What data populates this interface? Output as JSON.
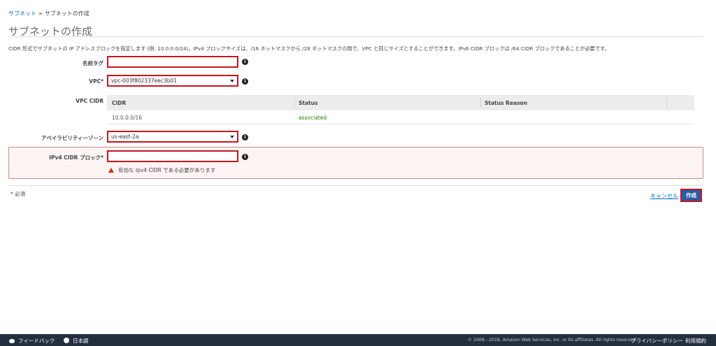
{
  "breadcrumb": {
    "root": "サブネット",
    "separator": " > ",
    "current": "サブネットの作成"
  },
  "page": {
    "title": "サブネットの作成",
    "description": "CIDR 形式でサブネットの IP アドレスブロックを指定します (例: 10.0.0.0/24)。IPv4 ブロックサイズは、/16 ネットマスクから /28 ネットマスクの間で、VPC と同じサイズとすることができます。IPv6 CIDR ブロックは /64 CIDR ブロックであることが必要です。"
  },
  "form": {
    "name_tag": {
      "label": "名前タグ",
      "value": ""
    },
    "vpc": {
      "label": "VPC*",
      "value": "vpc-003f802337eec3b01"
    },
    "vpc_cidr": {
      "label": "VPC CIDR",
      "columns": [
        "CIDR",
        "Status",
        "Status Reason"
      ],
      "rows": [
        {
          "cidr": "10.0.0.0/16",
          "status": "associated",
          "reason": ""
        }
      ]
    },
    "availability_zone": {
      "label": "アベイラビリティーゾーン",
      "value": "us-east-2a"
    },
    "ipv4_cidr": {
      "label": "IPv4 CIDR ブロック*",
      "value": "",
      "error": "有効な Ipv4 CIDR である必要があります"
    },
    "required_note": "* 必須"
  },
  "actions": {
    "cancel": "キャンセル",
    "create": "作成"
  },
  "footer": {
    "feedback": "フィードバック",
    "language": "日本語",
    "copyright": "© 2008 - 2018, Amazon Web Services, Inc. or its affiliates. All rights reserved.",
    "privacy": "プライバシーポリシー",
    "terms": "利用規約"
  },
  "icons": {
    "info": "info-icon",
    "warning": "warning-icon",
    "caret": "chevron-down-icon",
    "chat": "chat-icon",
    "globe": "globe-icon"
  },
  "colors": {
    "link": "#0073bb",
    "error_border": "#c7161f",
    "primary_button": "#2b5aa8",
    "status_ok": "#1d8102",
    "footer_bg": "#232f3e"
  }
}
